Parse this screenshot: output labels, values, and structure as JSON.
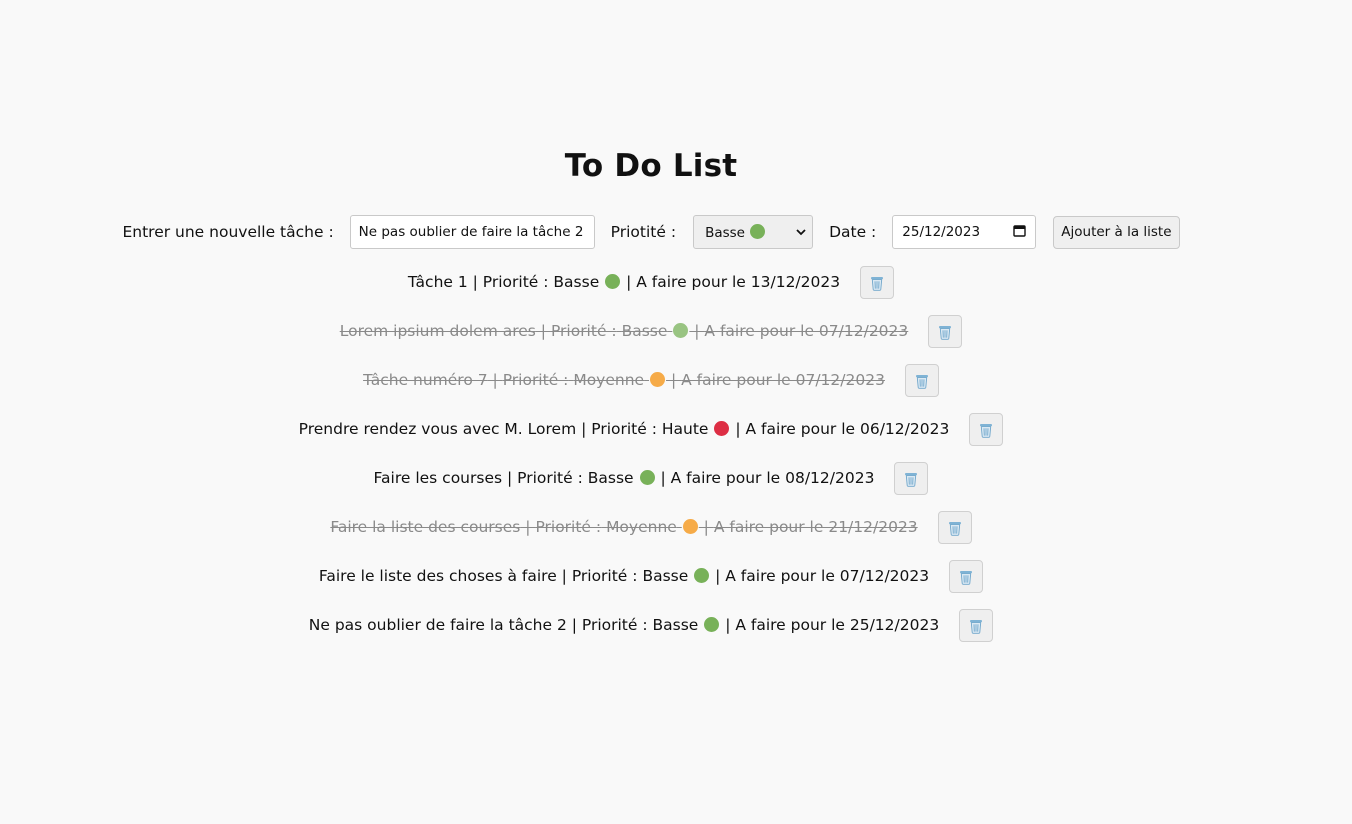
{
  "page": {
    "title": "To Do List"
  },
  "form": {
    "task_label": "Entrer une nouvelle tâche :",
    "task_value": "Ne pas oublier de faire la tâche 2",
    "priority_label": "Priotité :",
    "priority_selected": "Basse",
    "priority_selected_icon": "green-circle",
    "date_label": "Date :",
    "date_value": "25/12/2023",
    "add_button": "Ajouter à la liste"
  },
  "tasks": [
    {
      "name": "Tâche 1",
      "priority_prefix": "Priorité :",
      "priority": "Basse",
      "priority_color": "#78b159",
      "due_text": "A faire pour le 13/12/2023",
      "done": false
    },
    {
      "name": "Lorem ipsium dolem ares",
      "priority_prefix": "Priorité :",
      "priority": "Basse",
      "priority_color": "#78b159",
      "due_text": "A faire pour le 07/12/2023",
      "done": true
    },
    {
      "name": "Tâche numéro 7",
      "priority_prefix": "Priorité :",
      "priority": "Moyenne",
      "priority_color": "#f4900c",
      "due_text": "A faire pour le 07/12/2023",
      "done": true
    },
    {
      "name": "Prendre rendez vous avec M. Lorem",
      "priority_prefix": "Priorité :",
      "priority": "Haute",
      "priority_color": "#dd2e44",
      "due_text": "A faire pour le 06/12/2023",
      "done": false
    },
    {
      "name": "Faire les courses",
      "priority_prefix": "Priorité :",
      "priority": "Basse",
      "priority_color": "#78b159",
      "due_text": "A faire pour le 08/12/2023",
      "done": false
    },
    {
      "name": "Faire la liste des courses",
      "priority_prefix": "Priorité :",
      "priority": "Moyenne",
      "priority_color": "#f4900c",
      "due_text": "A faire pour le 21/12/2023",
      "done": true
    },
    {
      "name": "Faire le liste des choses à faire",
      "priority_prefix": "Priorité :",
      "priority": "Basse",
      "priority_color": "#78b159",
      "due_text": "A faire pour le 07/12/2023",
      "done": false
    },
    {
      "name": "Ne pas oublier de faire la tâche 2",
      "priority_prefix": "Priorité :",
      "priority": "Basse",
      "priority_color": "#78b159",
      "due_text": "A faire pour le 25/12/2023",
      "done": false
    }
  ],
  "icons": {
    "delete": "trash-icon",
    "calendar": "calendar-icon",
    "select": "chevron-down-icon"
  },
  "colors": {
    "background": "#f9f9f9",
    "done_text": "#8a8a8a",
    "low": "#78b159",
    "medium": "#f4900c",
    "high": "#dd2e44"
  }
}
